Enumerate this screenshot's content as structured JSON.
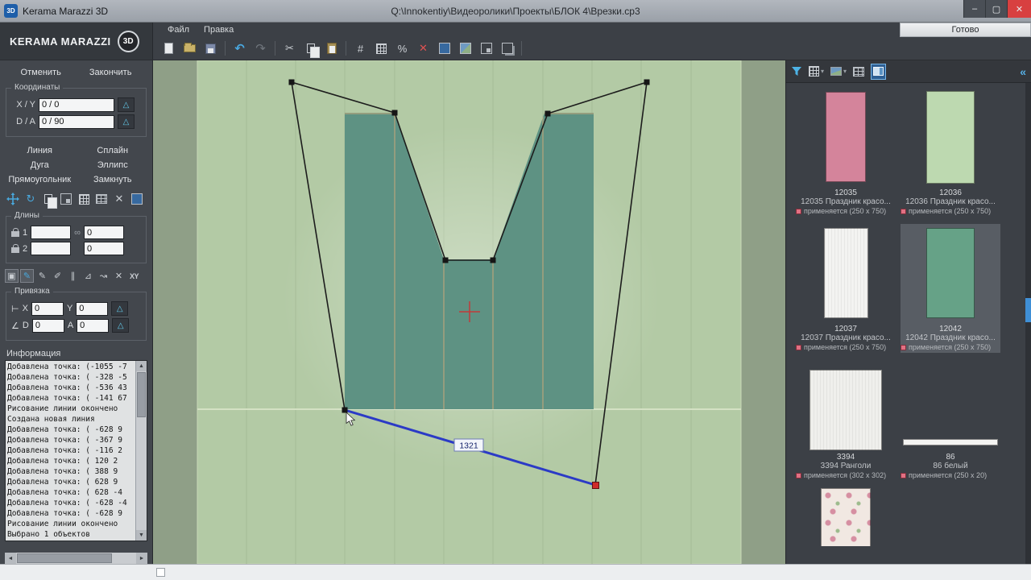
{
  "window": {
    "app_title": "Kerama Marazzi 3D",
    "doc_path": "Q:\\Innokentiy\\Видеоролики\\Проекты\\БЛОК 4\\Врезки.cp3",
    "app_badge": "3D",
    "minimize_glyph": "–",
    "maximize_glyph": "▢",
    "close_glyph": "✕"
  },
  "brand": {
    "name": "KERAMA MARAZZI",
    "badge": "3D"
  },
  "menubar": {
    "items": [
      "Файл",
      "Правка"
    ],
    "ready_label": "Готово"
  },
  "glyphs": {
    "undo": "↶",
    "redo": "↷",
    "cut": "✂",
    "grid": "#",
    "scale": "%",
    "delete": "✕",
    "rotate": "↻",
    "triangle": "△",
    "chain": "∞",
    "collapse": "«",
    "up": "▲",
    "down": "▼",
    "left": "◄",
    "right": "►",
    "snap_corner": "⊢",
    "snap_angle": "∠",
    "dropdown": "▾"
  },
  "toolbar_icons": [
    "new-document",
    "open-folder",
    "save",
    "undo",
    "redo",
    "cut",
    "copy",
    "paste",
    "grid",
    "tile-grid",
    "scale",
    "delete",
    "solid-view",
    "texture-view",
    "corner-view",
    "layers-view"
  ],
  "left_panel": {
    "cancel_label": "Отменить",
    "finish_label": "Закончить",
    "coordinates": {
      "title": "Координаты",
      "xy_label": "X / Y",
      "xy_value": "0 / 0",
      "da_label": "D / A",
      "da_value": "0 / 90"
    },
    "draw_tools": [
      "Линия",
      "Сплайн",
      "Дуга",
      "Эллипс",
      "Прямоугольник",
      "Замкнуть"
    ],
    "lengths": {
      "title": "Длины",
      "row1_label": "1",
      "row1_value1": "",
      "row1_value2": "0",
      "row2_label": "2",
      "row2_value1": "",
      "row2_value2": "0"
    },
    "mode_icons": [
      "▣",
      "✎",
      "✎",
      "✐",
      "∥",
      "⊿",
      "↝",
      "✕",
      "XY"
    ],
    "binding": {
      "title": "Привязка",
      "x_label": "X",
      "x_value": "0",
      "y_label": "Y",
      "y_value": "0",
      "d_label": "D",
      "d_value": "0",
      "a_label": "A",
      "a_value": "0"
    },
    "info": {
      "title": "Информация",
      "lines": [
        "Добавлена точка: (-1055  -7",
        "Добавлена точка: ( -328  -5",
        "Добавлена точка: ( -536  43",
        "Добавлена точка: ( -141  67",
        "Рисование линии окончено",
        "Создана новая линия",
        "Добавлена точка: ( -628  9",
        "Добавлена точка: ( -367  9",
        "Добавлена точка: ( -116  2",
        "Добавлена точка: (  120  2",
        "Добавлена точка: (  388  9",
        "Добавлена точка: (  628  9",
        "Добавлена точка: (  628  -4",
        "Добавлена точка: ( -628  -4",
        "Добавлена точка: ( -628  9",
        "Рисование линии окончено",
        "Выбрано 1 объектов"
      ]
    }
  },
  "canvas": {
    "dimension_label": "1321"
  },
  "right_panel": {
    "tiles": [
      {
        "id": "12035",
        "name": "12035 Праздник красо...",
        "applied": "применяется (250 x 750)",
        "color": "#d4849b"
      },
      {
        "id": "12036",
        "name": "12036 Праздник красо...",
        "applied": "применяется (250 x 750)",
        "color": "#bdd9b0"
      },
      {
        "id": "12037",
        "name": "12037 Праздник красо...",
        "applied": "применяется (250 x 750)",
        "color": "#f3f3f1"
      },
      {
        "id": "12042",
        "name": "12042 Праздник красо...",
        "applied": "применяется (250 x 750)",
        "color": "#66a287",
        "selected": true
      },
      {
        "id": "3394",
        "name": "3394 Ранголи",
        "applied": "применяется (302 x 302)",
        "color": "#efefec"
      },
      {
        "id": "86",
        "name": "86 белый",
        "applied": "применяется (250 x 20)",
        "color": "#f4f4f2"
      },
      {
        "id": "",
        "name": "",
        "applied": "",
        "color": "#f1e8e2"
      }
    ]
  }
}
